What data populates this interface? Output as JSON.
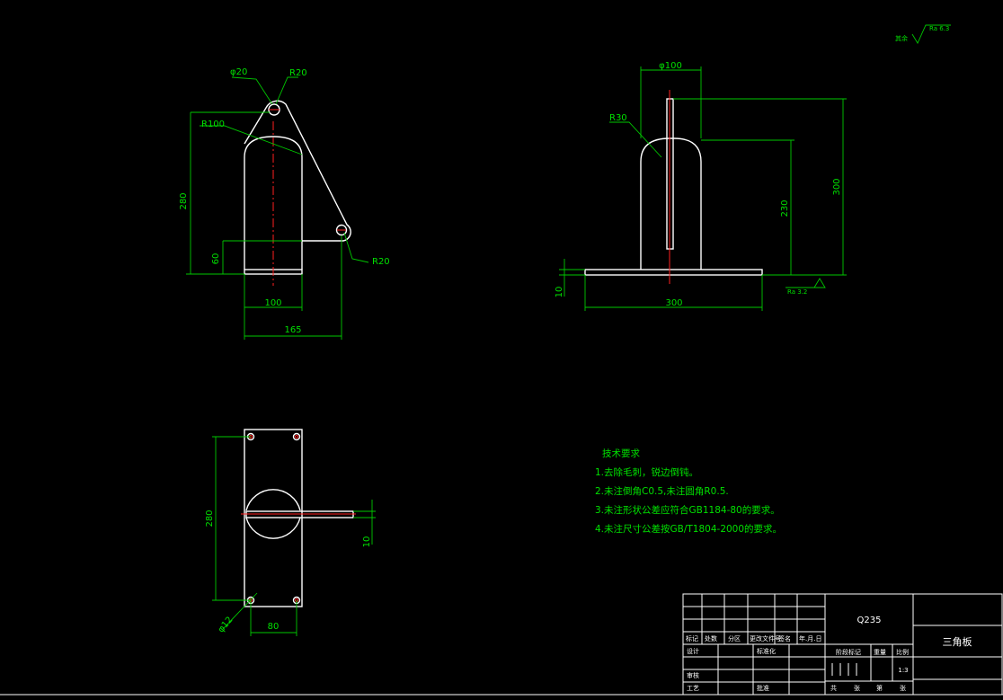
{
  "colors": {
    "background": "#000000",
    "outline": "#ffffff",
    "dimension": "#00c800",
    "centerline": "#ff2020"
  },
  "surface_finish": {
    "rest_label": "其余",
    "rest_value": "Ra 6.3",
    "base_value": "Ra 3.2"
  },
  "front_view": {
    "hole_dia": "φ20",
    "hole_radius_top": "R20",
    "arc_radius": "R100",
    "height": "280",
    "base_height": "60",
    "hole_radius_right": "R20",
    "width": "100",
    "total_width": "165"
  },
  "side_view": {
    "thickness": "φ100",
    "fillet": "R30",
    "height_230": "230",
    "height_300": "300",
    "base_thickness": "10",
    "base_width": "300"
  },
  "top_view": {
    "length": "280",
    "rib_thickness": "10",
    "hole_dia": "φ12",
    "hole_spacing": "80"
  },
  "tech_requirements": {
    "title": "技术要求",
    "items": [
      "1.去除毛刺，锐边倒钝。",
      "2.未注倒角C0.5,未注圆角R0.5.",
      "3.未注形状公差应符合GB1184-80的要求。",
      "4.未注尺寸公差按GB/T1804-2000的要求。"
    ]
  },
  "title_block": {
    "material": "Q235",
    "part_name": "三角板",
    "scale": "1:3",
    "row_labels": [
      "标记",
      "处数",
      "分区",
      "更改文件号",
      "签名",
      "年.月.日"
    ],
    "design": "设计",
    "standardize": "标准化",
    "stage_mark": "阶段标记",
    "weight": "重量",
    "scale_label": "比例",
    "review": "审核",
    "process": "工艺",
    "approve": "批准",
    "sheets_total": "共",
    "sheet": "张",
    "sheet_no": "第",
    "sheet_unit": "张"
  }
}
